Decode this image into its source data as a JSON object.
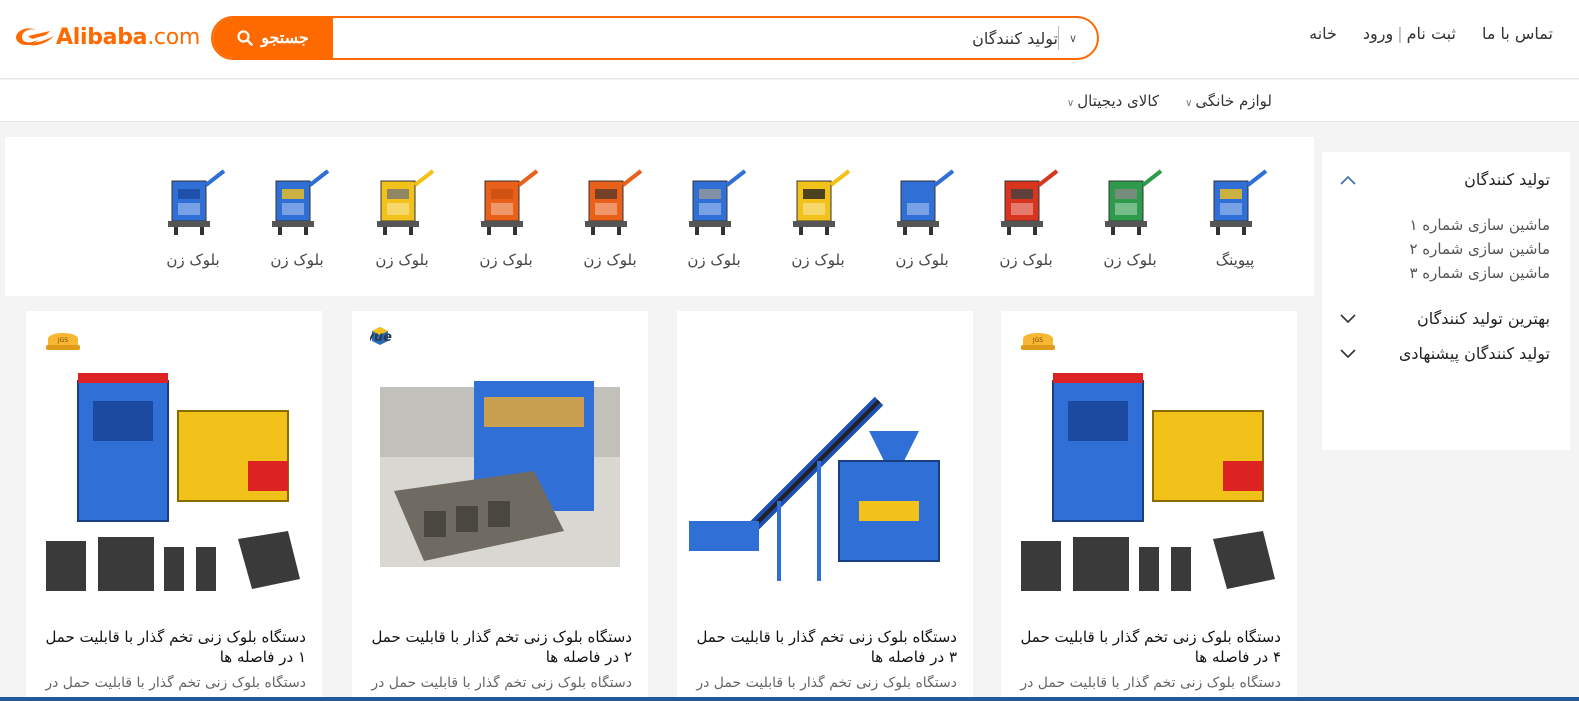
{
  "brand": {
    "name": "Alibaba",
    "domain": ".com",
    "color": "#ff6a00"
  },
  "search": {
    "category": "تولید کنندگان",
    "placeholder": "",
    "value": "",
    "button_label": "جستجو"
  },
  "top_nav": {
    "home": "خانه",
    "register": "ثبت نام",
    "login": "ورود",
    "contact": "تماس با ما"
  },
  "category_bar": [
    {
      "label": "کالای دیجیتال"
    },
    {
      "label": "لوازم خانگی"
    }
  ],
  "sidebar": {
    "section1": "تولید کنندگان",
    "sub_items": [
      "ماشین سازی شماره ۱",
      "ماشین سازی شماره ۲",
      "ماشین سازی شماره ۳"
    ],
    "section2": "بهترین تولید کنندگان",
    "section3": "تولید کنندگان پیشنهادی"
  },
  "strip_items": [
    {
      "label": "پیوینگ",
      "icon": "paving-machine"
    },
    {
      "label": "بلوک زن",
      "icon": "block-machine-green"
    },
    {
      "label": "بلوک زن",
      "icon": "block-machine-red-saw"
    },
    {
      "label": "بلوک زن",
      "icon": "block-machine-blue"
    },
    {
      "label": "بلوک زن",
      "icon": "block-machine-yellow"
    },
    {
      "label": "بلوک زن",
      "icon": "block-machine-conveyor"
    },
    {
      "label": "بلوک زن",
      "icon": "manual-press-orange"
    },
    {
      "label": "بلوک زن",
      "icon": "manual-press-orange-2"
    },
    {
      "label": "بلوک زن",
      "icon": "mobile-block-machine"
    },
    {
      "label": "بلوک زن",
      "icon": "block-machine-blue-large"
    },
    {
      "label": "بلوک زن",
      "icon": "block-machine-blue-small"
    }
  ],
  "products": [
    {
      "title": "دستگاه بلوک زنی تخم گذار با قابلیت حمل ۴ در فاصله ها",
      "desc": "دستگاه بلوک زنی تخم گذار با قابلیت حمل در",
      "badge": "gold-badge"
    },
    {
      "title": "دستگاه بلوک زنی تخم گذار با قابلیت حمل ۳ در فاصله ها",
      "desc": "دستگاه بلوک زنی تخم گذار با قابلیت حمل در",
      "badge": ""
    },
    {
      "title": "دستگاه بلوک زنی تخم گذار با قابلیت حمل ۲ در فاصله ها",
      "desc": "دستگاه بلوک زنی تخم گذار با قابلیت حمل در",
      "badge": "Qunyue"
    },
    {
      "title": "دستگاه بلوک زنی تخم گذار با قابلیت حمل ۱ در فاصله ها",
      "desc": "دستگاه بلوک زنی تخم گذار با قابلیت حمل در",
      "badge": "gold-badge"
    }
  ]
}
